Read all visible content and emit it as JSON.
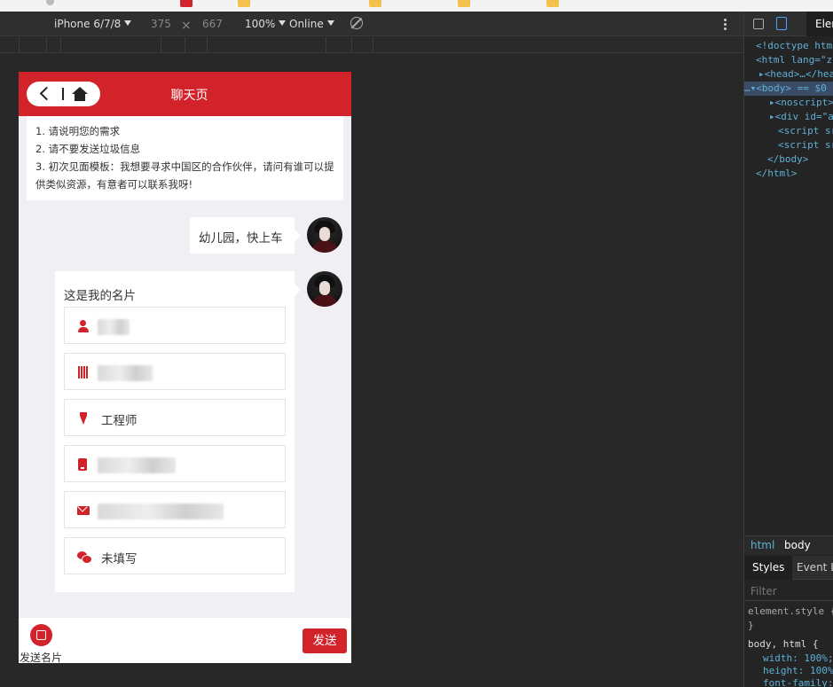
{
  "device_toolbar": {
    "device": "iPhone 6/7/8",
    "width": "375",
    "times": "×",
    "height": "667",
    "zoom": "100%",
    "network": "Online"
  },
  "phone": {
    "nav_title": "聊天页",
    "notice_lines": [
      "1. 请说明您的需求",
      "2. 请不要发送垃圾信息",
      "3. 初次见面模板：我想要寻求中国区的合作伙伴，请问有谁可以提供类似资源，有意者可以联系我呀!"
    ],
    "message_text": "幼儿园，快上车",
    "card": {
      "title": "这是我的名片",
      "fields": [
        {
          "icon": "user-icon",
          "value": "",
          "redacted": true
        },
        {
          "icon": "building-icon",
          "value": "",
          "redacted": true
        },
        {
          "icon": "tie-icon",
          "value": "工程师",
          "redacted": false
        },
        {
          "icon": "mobile-icon",
          "value": "",
          "redacted": true
        },
        {
          "icon": "mail-icon",
          "value": "",
          "redacted": true
        },
        {
          "icon": "wechat-icon",
          "value": "未填写",
          "redacted": false
        }
      ]
    },
    "send_card_label": "发送名片",
    "send_label": "发送",
    "accent_color": "#d2232a"
  },
  "devtools": {
    "elements_tab": "Elem",
    "dom_lines": {
      "doctype": "<!doctype htm",
      "html_open": "<html lang=\"zh",
      "head": "<head>…</hea",
      "body": "<body> == $0",
      "noscript": "<noscript>",
      "div_app": "<div id=\"a",
      "script1": "<script sr",
      "script2": "<script sr",
      "body_close": "</body>",
      "html_close": "</html>"
    },
    "crumb_html": "html",
    "crumb_body": "body",
    "styles_tab": "Styles",
    "event_tab": "Event Li",
    "filter_placeholder": "Filter",
    "element_style": "element.style {",
    "brace_close": "}",
    "rule_selector": "body, html {",
    "prop_width": "width: 100%;",
    "prop_height": "height: 100%",
    "prop_font": "font-family:"
  }
}
